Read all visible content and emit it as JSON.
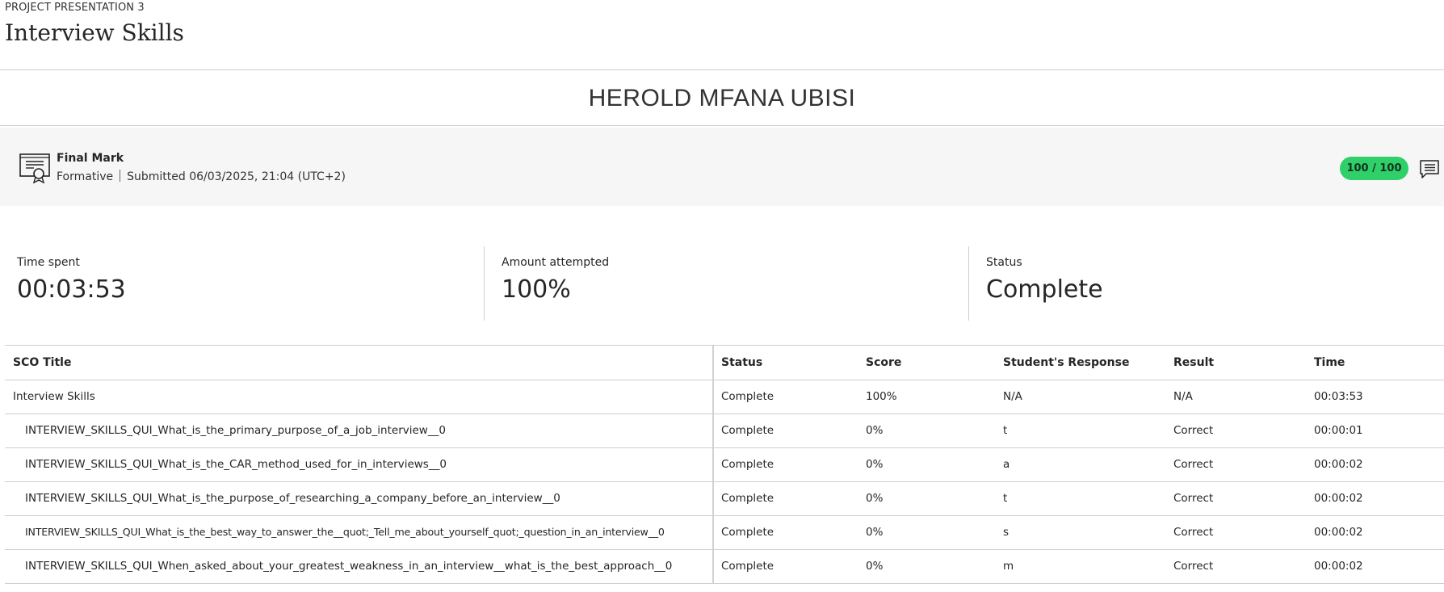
{
  "header": {
    "course_label": "PROJECT PRESENTATION 3",
    "title": "Interview Skills"
  },
  "student": {
    "name": "HEROLD MFANA UBISI"
  },
  "final_mark": {
    "icon": "certificate-icon",
    "title": "Final Mark",
    "type": "Formative",
    "submitted": "Submitted 06/03/2025, 21:04 (UTC+2)",
    "score": "100 / 100",
    "score_color": "#2fcf6a",
    "comment_icon": "comment-icon"
  },
  "stats": [
    {
      "label": "Time spent",
      "value": "00:03:53"
    },
    {
      "label": "Amount attempted",
      "value": "100%"
    },
    {
      "label": "Status",
      "value": "Complete"
    }
  ],
  "table": {
    "headers": {
      "title": "SCO Title",
      "status": "Status",
      "score": "Score",
      "response": "Student's Response",
      "result": "Result",
      "time": "Time"
    },
    "rows": [
      {
        "title": "Interview Skills",
        "status": "Complete",
        "score": "100%",
        "response": "N/A",
        "result": "N/A",
        "time": "00:03:53"
      },
      {
        "title": "INTERVIEW_SKILLS_QUI_What_is_the_primary_purpose_of_a_job_interview__0",
        "status": "Complete",
        "score": "0%",
        "response": "t",
        "result": "Correct",
        "time": "00:00:01"
      },
      {
        "title": "INTERVIEW_SKILLS_QUI_What_is_the_CAR_method_used_for_in_interviews__0",
        "status": "Complete",
        "score": "0%",
        "response": "a",
        "result": "Correct",
        "time": "00:00:02"
      },
      {
        "title": "INTERVIEW_SKILLS_QUI_What_is_the_purpose_of_researching_a_company_before_an_interview__0",
        "status": "Complete",
        "score": "0%",
        "response": "t",
        "result": "Correct",
        "time": "00:00:02"
      },
      {
        "title": "INTERVIEW_SKILLS_QUI_What_is_the_best_way_to_answer_the__quot;_Tell_me_about_yourself_quot;_question_in_an_interview__0",
        "status": "Complete",
        "score": "0%",
        "response": "s",
        "result": "Correct",
        "time": "00:00:02"
      },
      {
        "title": "INTERVIEW_SKILLS_QUI_When_asked_about_your_greatest_weakness_in_an_interview__what_is_the_best_approach__0",
        "status": "Complete",
        "score": "0%",
        "response": "m",
        "result": "Correct",
        "time": "00:00:02"
      }
    ]
  }
}
